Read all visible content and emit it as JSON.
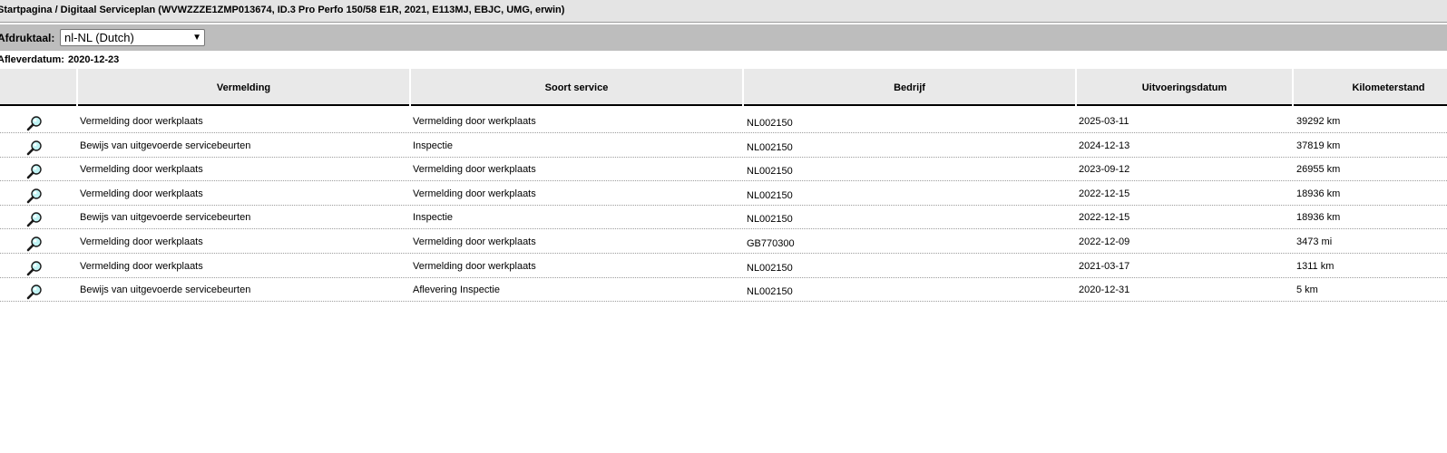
{
  "breadcrumb": "Startpagina / Digitaal Serviceplan (WVWZZZE1ZMP013674, ID.3 Pro Perfo 150/58 E1R, 2021, E113MJ, EBJC, UMG, erwin)",
  "print_language": {
    "label": "Afdruktaal:",
    "selected": "nl-NL (Dutch)"
  },
  "delivery_date": {
    "label": "Afleverdatum:",
    "value": "2020-12-23"
  },
  "table": {
    "columns": [
      "Vermelding",
      "Soort service",
      "Bedrijf",
      "Uitvoeringsdatum",
      "Kilometerstand"
    ],
    "rows": [
      {
        "vermelding": "Vermelding door werkplaats",
        "soort": "Vermelding door werkplaats",
        "bedrijf": "NL002150",
        "datum": "2025-03-11",
        "km": "39292 km"
      },
      {
        "vermelding": "Bewijs van uitgevoerde servicebeurten",
        "soort": "Inspectie",
        "bedrijf": "NL002150",
        "datum": "2024-12-13",
        "km": "37819 km"
      },
      {
        "vermelding": "Vermelding door werkplaats",
        "soort": "Vermelding door werkplaats",
        "bedrijf": "NL002150",
        "datum": "2023-09-12",
        "km": "26955 km"
      },
      {
        "vermelding": "Vermelding door werkplaats",
        "soort": "Vermelding door werkplaats",
        "bedrijf": "NL002150",
        "datum": "2022-12-15",
        "km": "18936 km"
      },
      {
        "vermelding": "Bewijs van uitgevoerde servicebeurten",
        "soort": "Inspectie",
        "bedrijf": "NL002150",
        "datum": "2022-12-15",
        "km": "18936 km"
      },
      {
        "vermelding": "Vermelding door werkplaats",
        "soort": "Vermelding door werkplaats",
        "bedrijf": "GB770300",
        "datum": "2022-12-09",
        "km": "3473 mi"
      },
      {
        "vermelding": "Vermelding door werkplaats",
        "soort": "Vermelding door werkplaats",
        "bedrijf": "NL002150",
        "datum": "2021-03-17",
        "km": "1311 km"
      },
      {
        "vermelding": "Bewijs van uitgevoerde servicebeurten",
        "soort": "Aflevering Inspectie",
        "bedrijf": "NL002150",
        "datum": "2020-12-31",
        "km": "5 km"
      }
    ]
  },
  "icons": {
    "row_detail": "magnifier-icon",
    "dropdown": "chevron-down-icon"
  }
}
